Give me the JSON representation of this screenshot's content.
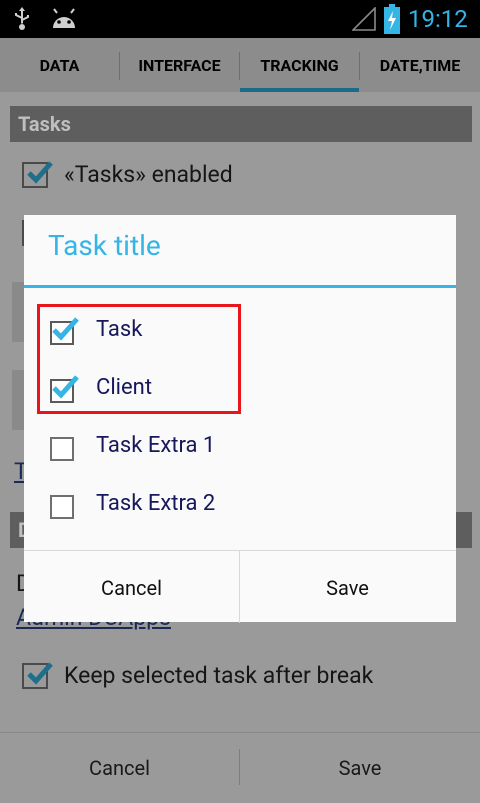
{
  "status_bar": {
    "time": "19:12",
    "icons": [
      "usb-icon",
      "android-icon",
      "signal-icon",
      "battery-charging-icon"
    ]
  },
  "tabs": [
    {
      "label": "DATA",
      "active": false
    },
    {
      "label": "INTERFACE",
      "active": false
    },
    {
      "label": "TRACKING",
      "active": true
    },
    {
      "label": "DATE,TIME",
      "active": false
    }
  ],
  "background": {
    "section_tasks": "Tasks",
    "tasks_enabled_label": "«Tasks» enabled",
    "fragment_t": "T",
    "fragment_d_section": "D",
    "fragment_d_text": "D",
    "admin_link": "Admin DCApps",
    "keep_task_label": "Keep selected task after break",
    "cancel_label": "Cancel",
    "save_label": "Save"
  },
  "dialog": {
    "title": "Task title",
    "items": [
      {
        "label": "Task",
        "checked": true
      },
      {
        "label": "Client",
        "checked": true
      },
      {
        "label": "Task Extra 1",
        "checked": false
      },
      {
        "label": "Task Extra 2",
        "checked": false
      }
    ],
    "cancel_label": "Cancel",
    "save_label": "Save"
  },
  "colors": {
    "accent": "#35b5e5",
    "highlight": "#e8161b",
    "scrim": "#9a9a9a"
  }
}
